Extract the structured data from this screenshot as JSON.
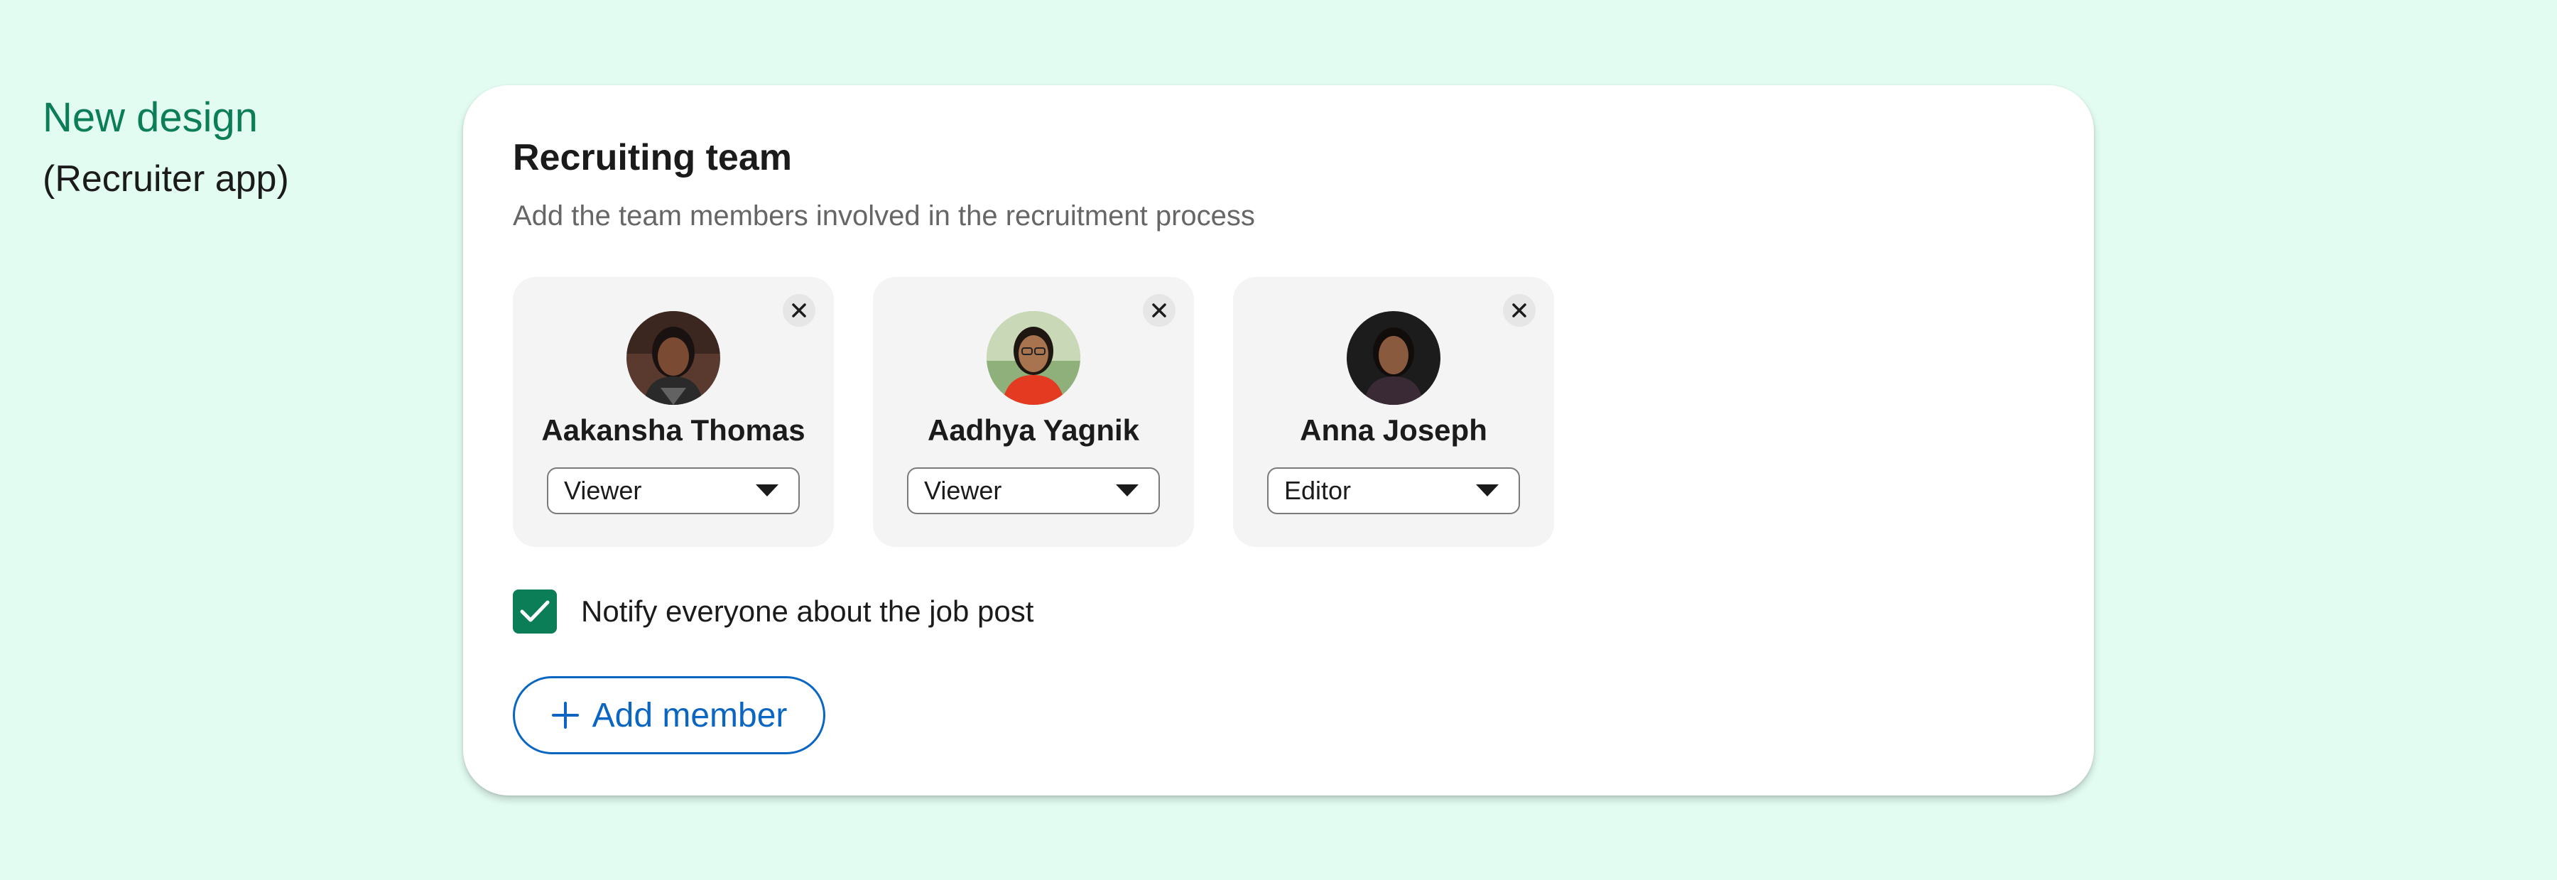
{
  "labels": {
    "title": "New design",
    "subtitle": "(Recruiter app)"
  },
  "recruiting_team": {
    "title": "Recruiting team",
    "subtitle": "Add the team members involved in the recruitment process",
    "members": [
      {
        "name": "Aakansha Thomas",
        "role": "Viewer"
      },
      {
        "name": "Aadhya Yagnik",
        "role": "Viewer"
      },
      {
        "name": "Anna Joseph",
        "role": "Editor"
      }
    ],
    "notify": {
      "label": "Notify everyone about the job post",
      "checked": true
    },
    "add_member_label": "Add member"
  },
  "icons": {
    "remove": "close-icon",
    "dropdown": "caret-down-icon",
    "checkbox": "checkmark-icon",
    "add": "plus-icon"
  },
  "colors": {
    "page_background": "#e2fcf1",
    "accent_green": "#0b7d57",
    "link_blue": "#0a66c2",
    "card_background": "#f4f4f4"
  }
}
